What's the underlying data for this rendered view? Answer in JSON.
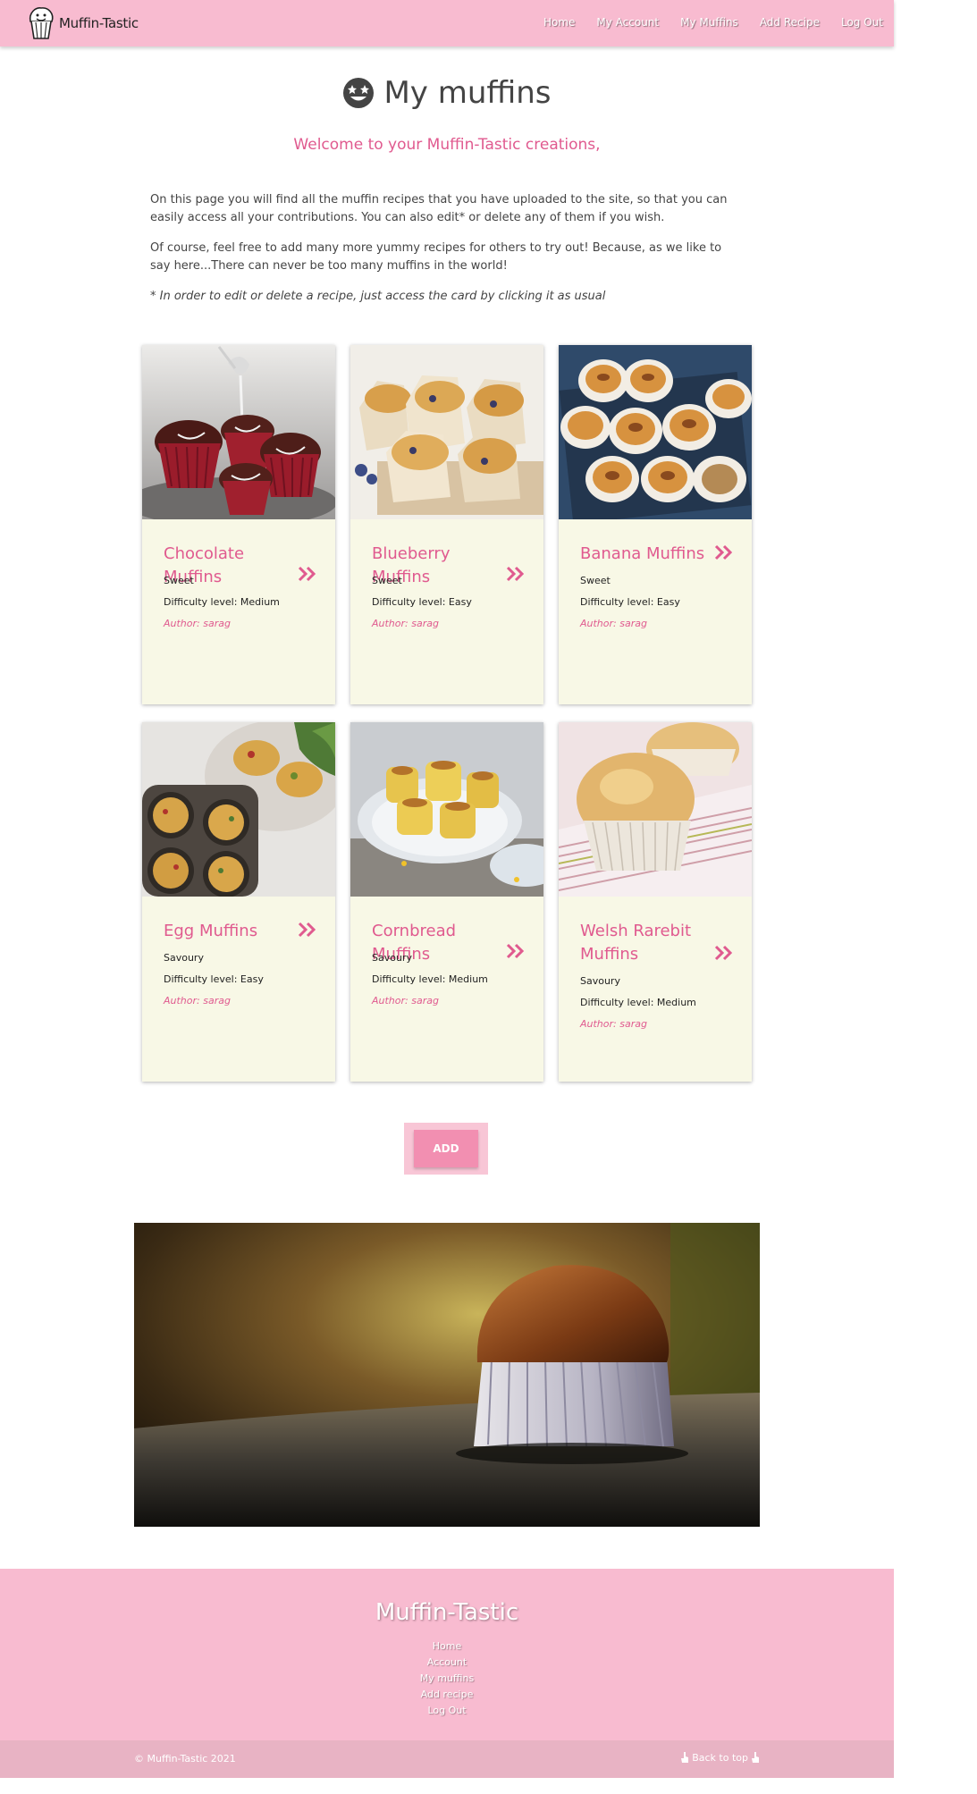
{
  "navbar": {
    "brand": "Muffin-Tastic",
    "links": [
      "Home",
      "My Account",
      "My Muffins",
      "Add Recipe",
      "Log Out"
    ]
  },
  "header": {
    "title": "My muffins",
    "welcome": "Welcome to your Muffin-Tastic creations,",
    "paragraph_1": "On this page you will find all the muffin recipes that you have uploaded to the site, so that you can easily access all your contributions. You can also edit* or delete any of them if you wish.",
    "paragraph_2": "Of course, feel free to add many more yummy recipes for others to try out! Because, as we like to say here...There can never be too many muffins in the world!",
    "note": "* In order to edit or delete a recipe, just access the card by clicking it as usual"
  },
  "cards": [
    {
      "title": "Chocolate Muffins",
      "category": "Sweet",
      "difficulty": "Difficulty level: Medium",
      "author": "Author: sarag"
    },
    {
      "title": "Blueberry Muffins",
      "category": "Sweet",
      "difficulty": "Difficulty level: Easy",
      "author": "Author: sarag"
    },
    {
      "title": "Banana Muffins",
      "category": "Sweet",
      "difficulty": "Difficulty level: Easy",
      "author": "Author: sarag"
    },
    {
      "title": "Egg Muffins",
      "category": "Savoury",
      "difficulty": "Difficulty level: Easy",
      "author": "Author: sarag"
    },
    {
      "title": "Cornbread Muffins",
      "category": "Savoury",
      "difficulty": "Difficulty level: Medium",
      "author": "Author: sarag"
    },
    {
      "title": "Welsh Rarebit Muffins",
      "category": "Savoury",
      "difficulty": "Difficulty level: Medium",
      "author": "Author: sarag"
    }
  ],
  "add_button": "ADD",
  "footer": {
    "title": "Muffin-Tastic",
    "links": [
      "Home",
      "Account",
      "My muffins",
      "Add recipe",
      "Log Out"
    ],
    "copyright": "© Muffin-Tastic 2021",
    "back_to_top": "Back to top"
  },
  "colors": {
    "brand_pink": "#f8bbd0",
    "accent_pink": "#e05a8f",
    "card_background": "#f8f8e6",
    "button_pink": "#f28fb1"
  },
  "icons": {
    "brand": "muffin-logo-icon",
    "title": "star-struck-face-icon",
    "card_link": "double-chevron-right-icon",
    "back_to_top": "pointing-hand-icon"
  }
}
